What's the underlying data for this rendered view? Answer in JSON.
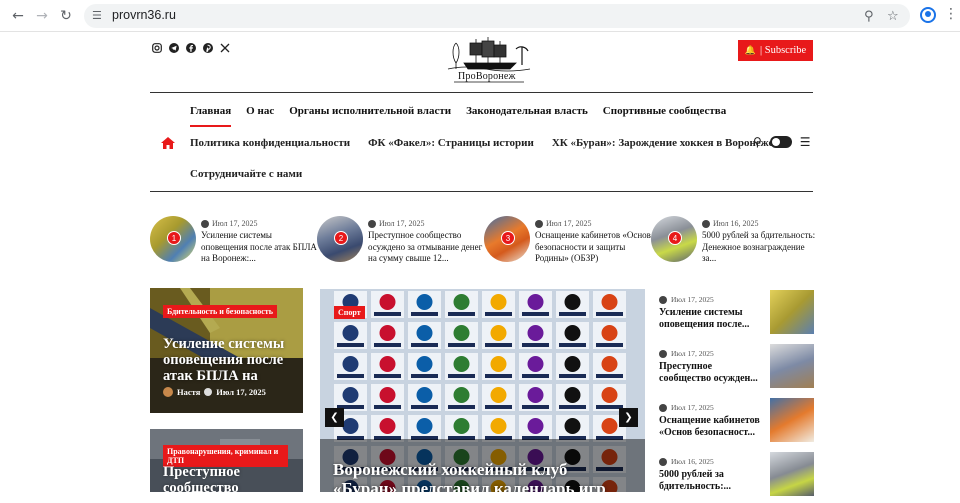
{
  "browser": {
    "url": "provrn36.ru"
  },
  "site": {
    "logo_text": "ПроВоронеж",
    "subscribe_label": "| Subscribe",
    "socials": [
      "instagram-icon",
      "telegram-icon",
      "facebook-icon",
      "pinterest-icon",
      "x-icon"
    ]
  },
  "menu": {
    "primary": [
      {
        "label": "Главная",
        "active": true
      },
      {
        "label": "О нас"
      },
      {
        "label": "Органы исполнительной власти"
      },
      {
        "label": "Законодательная власть"
      },
      {
        "label": "Спортивные сообщества"
      }
    ],
    "secondary": [
      {
        "label": "Политика конфиденциальности"
      },
      {
        "label": "ФК «Факел»: Страницы истории"
      },
      {
        "label": "ХК «Буран»: Зарождение хоккея в Воронеже"
      }
    ],
    "third": "Сотрудничайте с нами"
  },
  "trending": [
    {
      "num": "1",
      "date": "Июл 17, 2025",
      "title": "Усиление системы оповещения после атак БПЛА на Воронеж:..."
    },
    {
      "num": "2",
      "date": "Июл 17, 2025",
      "title": "Преступное сообщество осуждено за отмывание денег на сумму свыше 12..."
    },
    {
      "num": "3",
      "date": "Июл 17, 2025",
      "title": "Оснащение кабинетов «Основ безопасности и защиты Родины» (ОБЗР)"
    },
    {
      "num": "4",
      "date": "Июл 16, 2025",
      "title": "5000 рублей за бдительность: Денежное вознаграждение за..."
    }
  ],
  "cards": [
    {
      "category": "Бдительность и безопасность",
      "title": "Усиление системы оповещения после атак БПЛА на",
      "author": "Настя",
      "date": "Июл 17, 2025"
    },
    {
      "category": "Правонарушения, криминал и ДТП",
      "title": "Преступное сообщество"
    }
  ],
  "slider": {
    "category": "Спорт",
    "title": "Воронежский хоккейный клуб «Буран» представил календарь игр"
  },
  "side_list": [
    {
      "date": "Июл 17, 2025",
      "title": "Усиление системы оповещения после..."
    },
    {
      "date": "Июл 17, 2025",
      "title": "Преступное сообщество осужден..."
    },
    {
      "date": "Июл 17, 2025",
      "title": "Оснащение кабинетов «Основ безопасност..."
    },
    {
      "date": "Июл 16, 2025",
      "title": "5000 рублей за бдительность:..."
    }
  ],
  "colors": {
    "accent": "#e8191a",
    "text": "#222222"
  }
}
